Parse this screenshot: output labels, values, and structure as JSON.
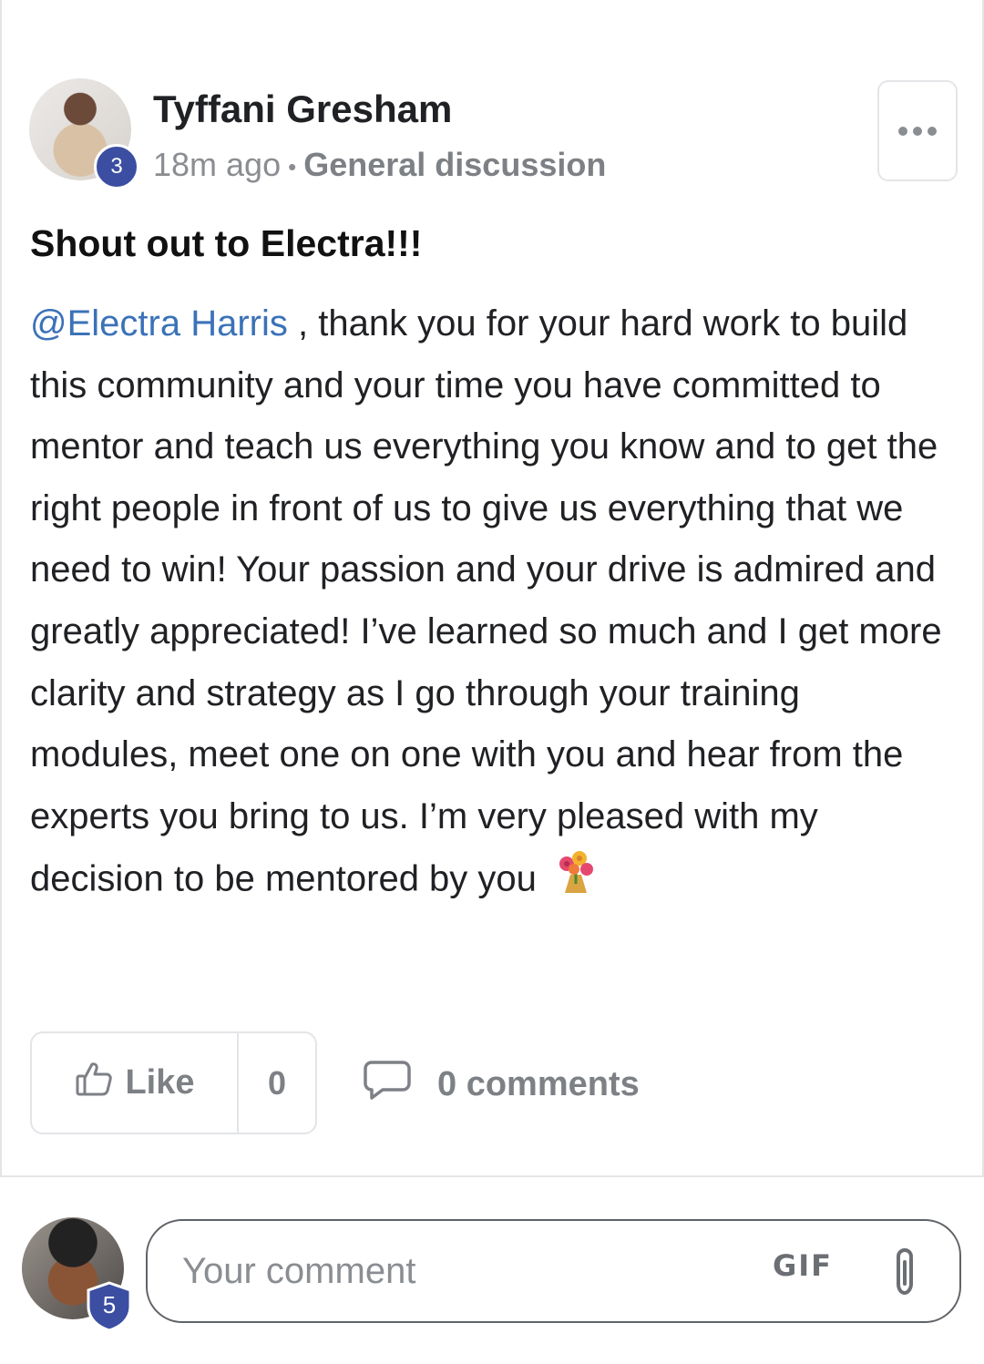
{
  "post": {
    "author": {
      "name": "Tyffani Gresham",
      "level": "3"
    },
    "time_ago": "18m ago",
    "separator": "•",
    "category": "General discussion",
    "title": "Shout out to Electra!!!",
    "mention": "@Electra Harris",
    "body": " , thank you for your hard work to build this community and your time you have committed to mentor and teach us everything you know and to get the right people in front of us to give us everything that we need to win! Your passion and your drive is admired and greatly appreciated! I’ve learned so much and I get more clarity and strategy as I go through your training modules, meet one on one with you and hear from the experts you bring to us. I’m very pleased with my decision to be mentored by you",
    "emoji": "bouquet-icon",
    "actions": {
      "like_label": "Like",
      "like_count": "0",
      "comments_label": "0 comments"
    }
  },
  "composer": {
    "user_level": "5",
    "placeholder": "Your comment",
    "gif_label": "GIF"
  },
  "colors": {
    "mention": "#3b72b8",
    "badge": "#3b4ea1",
    "muted": "#7d8085"
  }
}
